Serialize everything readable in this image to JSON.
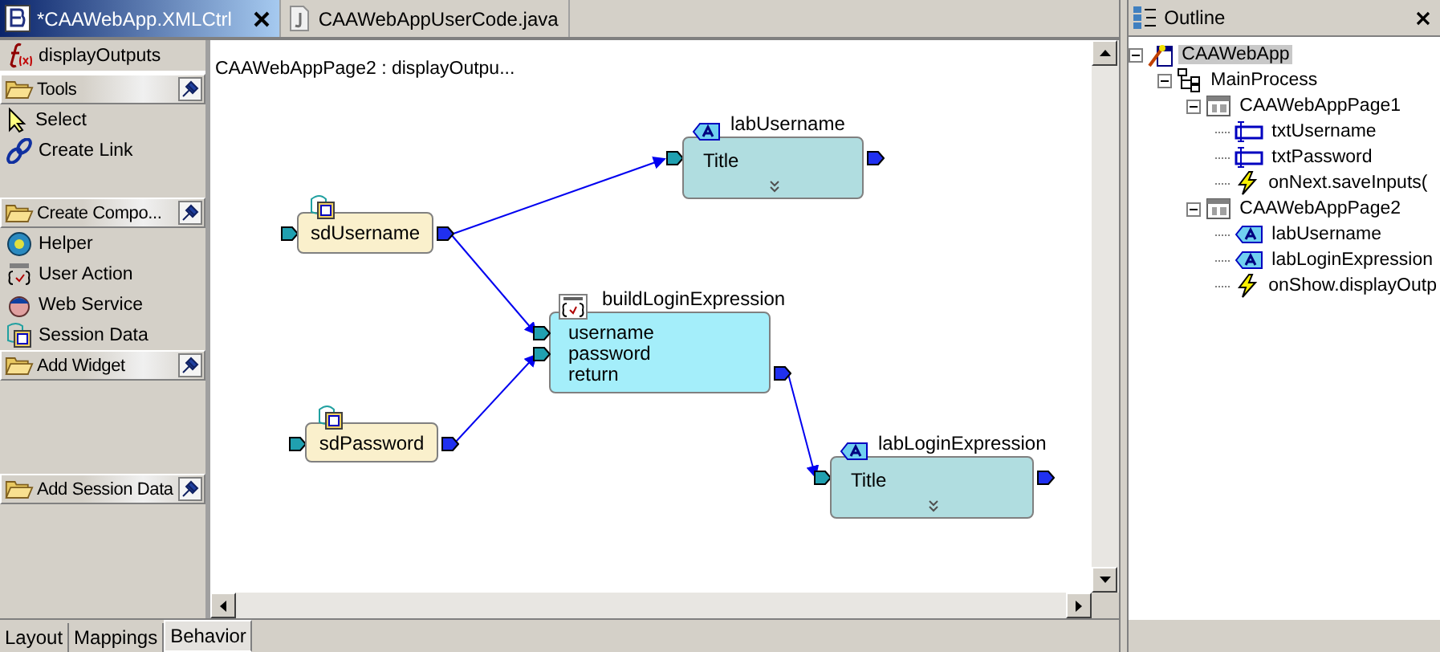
{
  "editor_tabs": [
    {
      "label": "*CAAWebApp.XMLCtrl",
      "selected": true,
      "kind": "xml"
    },
    {
      "label": "CAAWebAppUserCode.java",
      "selected": false,
      "kind": "java"
    }
  ],
  "palette": {
    "title": "displayOutputs",
    "drawers": [
      {
        "label": "Tools",
        "items": [
          {
            "label": "Select",
            "kind": "select"
          },
          {
            "label": "Create Link",
            "kind": "link"
          }
        ]
      },
      {
        "label": "Create Compo...",
        "items": [
          {
            "label": "Helper",
            "kind": "helper"
          },
          {
            "label": "User Action",
            "kind": "action"
          },
          {
            "label": "Web Service",
            "kind": "service"
          },
          {
            "label": "Session Data",
            "kind": "session"
          }
        ]
      },
      {
        "label": "Add Widget"
      },
      {
        "label": "Add Session Data"
      }
    ]
  },
  "canvas": {
    "caption": "CAAWebAppPage2 : displayOutpu...",
    "nodes": [
      {
        "kind": "data",
        "name": "sdUsername"
      },
      {
        "kind": "label",
        "name": "labUsername",
        "body": "Title"
      },
      {
        "kind": "function",
        "name": "buildLoginExpression",
        "params": [
          "username",
          "password",
          "return"
        ]
      },
      {
        "kind": "data",
        "name": "sdPassword"
      },
      {
        "kind": "label",
        "name": "labLoginExpression",
        "body": "Title"
      }
    ]
  },
  "bottom_tabs": [
    {
      "label": "Layout",
      "selected": false
    },
    {
      "label": "Mappings",
      "selected": false
    },
    {
      "label": "Behavior",
      "selected": true
    }
  ],
  "outline": {
    "title": "Outline",
    "tree": [
      {
        "label": "CAAWebApp",
        "kind": "app",
        "selected": true,
        "expanded": true,
        "children": [
          {
            "label": "MainProcess",
            "kind": "process",
            "selected": false,
            "expanded": true,
            "children": [
              {
                "label": "CAAWebAppPage1",
                "kind": "page",
                "selected": false,
                "expanded": true,
                "children": [
                  {
                    "label": "txtUsername",
                    "kind": "field",
                    "selected": false
                  },
                  {
                    "label": "txtPassword",
                    "kind": "field",
                    "selected": false
                  },
                  {
                    "label": "onNext.saveInputs(",
                    "kind": "event",
                    "selected": false
                  }
                ]
              },
              {
                "label": "CAAWebAppPage2",
                "kind": "page",
                "selected": false,
                "expanded": true,
                "children": [
                  {
                    "label": "labUsername",
                    "kind": "label",
                    "selected": false
                  },
                  {
                    "label": "labLoginExpression",
                    "kind": "label",
                    "selected": false
                  },
                  {
                    "label": "onShow.displayOutp",
                    "kind": "event",
                    "selected": false
                  }
                ]
              }
            ]
          }
        ]
      }
    ]
  }
}
